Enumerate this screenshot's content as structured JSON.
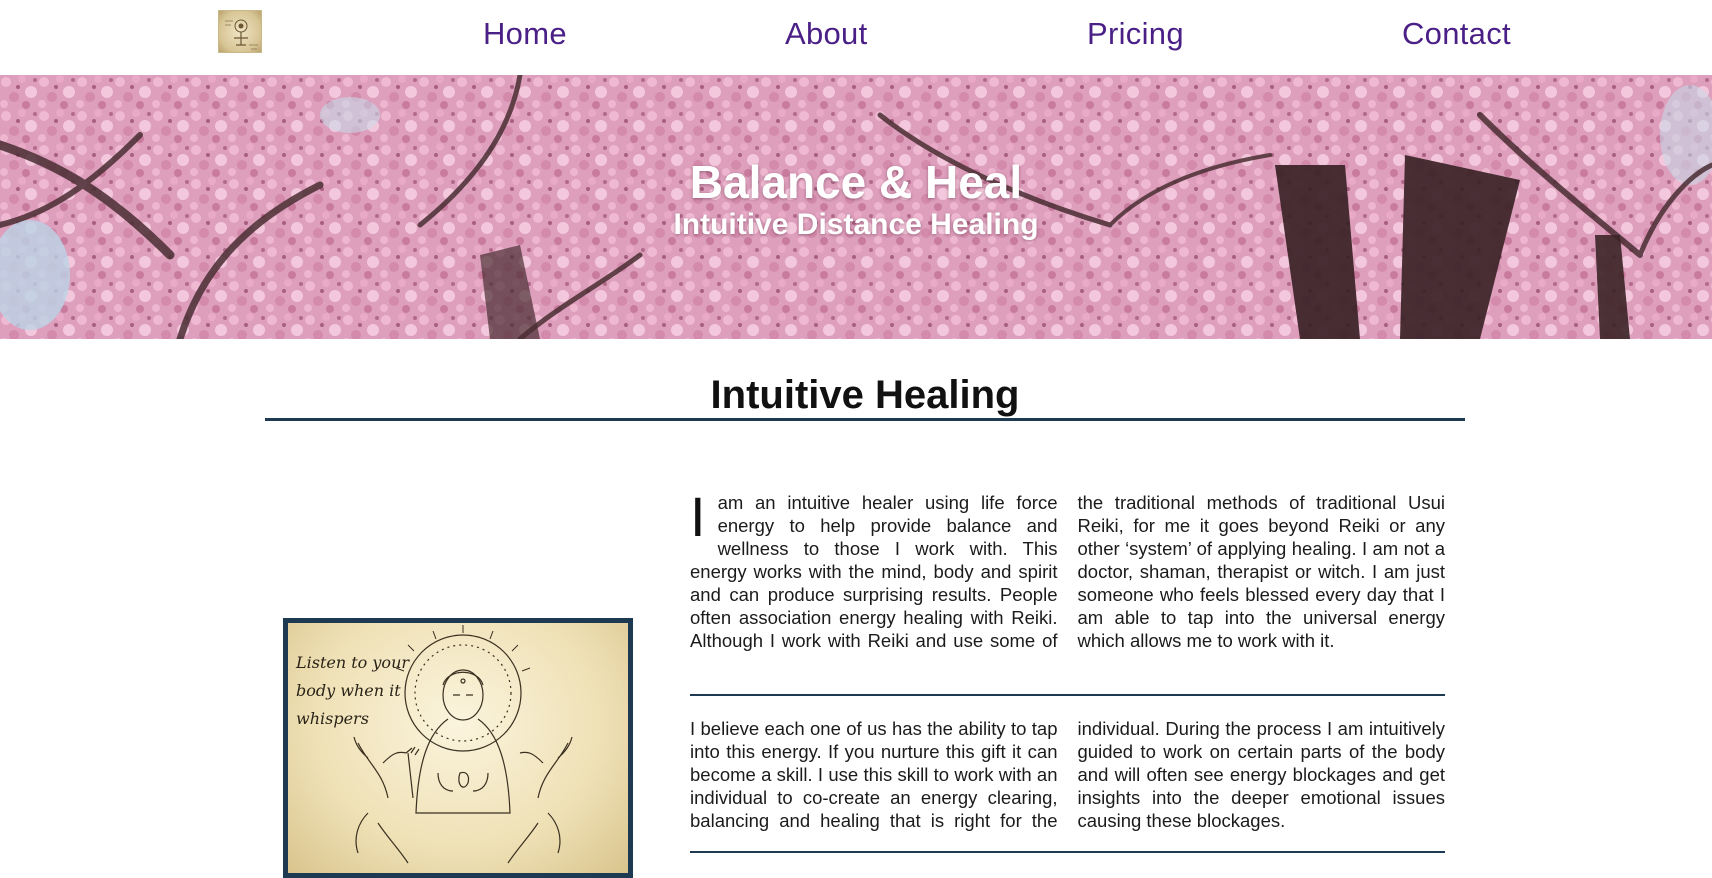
{
  "nav": {
    "logo_icon": "logo-icon",
    "links": [
      "Home",
      "About",
      "Pricing",
      "Contact"
    ],
    "link_color": "#4a1f86"
  },
  "hero": {
    "title": "Balance & Heal",
    "subtitle": "Intuitive Distance Healing"
  },
  "section": {
    "title": "Intuitive Healing",
    "rule_color": "#1e3a52"
  },
  "artwork": {
    "lines": [
      "Listen to your",
      "body when it",
      "whispers"
    ]
  },
  "content": {
    "para1_dropcap": "I",
    "para1_rest": "am an intuitive healer using life force energy to help provide balance and wellness to those I work with. This energy works with the mind, body and spirit and can produce surprising results. People often association energy healing with Reiki. Although I work with Reiki and use some of the traditional methods of traditional Usui Reiki, for me it goes beyond Reiki or any other ‘system’ of applying healing. I am not a doctor, shaman, therapist or witch. I am just someone who feels blessed every day that I am able to tap into the universal energy which allows me to work with it.",
    "para2": "I believe each one of us has the ability to tap into this energy. If you nurture this gift it can become a skill. I use this skill to work with an individual to co-create an energy clearing, balancing and healing that is right for the individual. During the process I am intuitively guided to work on certain parts of the body and will often see energy blockages and get insights into the deeper emotional issues causing these blockages."
  }
}
